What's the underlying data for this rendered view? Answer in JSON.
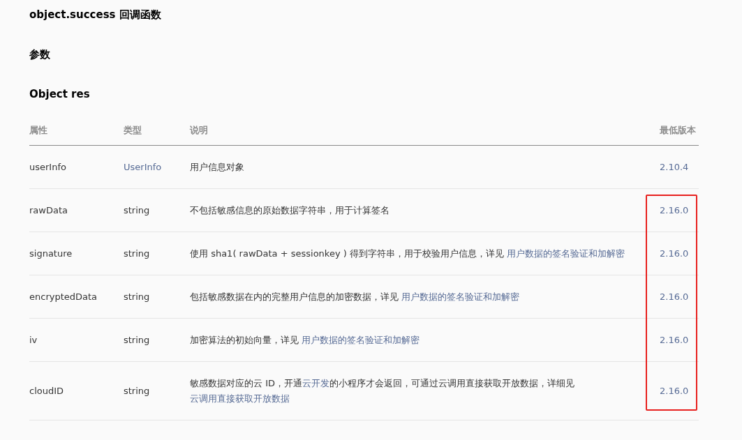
{
  "title": "object.success 回调函数",
  "section": "参数",
  "object_title": "Object res",
  "table": {
    "columns": [
      "属性",
      "类型",
      "说明",
      "最低版本"
    ],
    "rows": [
      {
        "name": "userInfo",
        "type": "UserInfo",
        "type_link": true,
        "description": [
          {
            "text": "用户信息对象",
            "link": false
          }
        ],
        "version": "2.10.4",
        "highlighted": false
      },
      {
        "name": "rawData",
        "type": "string",
        "type_link": false,
        "description": [
          {
            "text": "不包括敏感信息的原始数据字符串，用于计算签名",
            "link": false
          }
        ],
        "version": "2.16.0",
        "highlighted": true
      },
      {
        "name": "signature",
        "type": "string",
        "type_link": false,
        "description": [
          {
            "text": "使用 sha1( rawData + sessionkey ) 得到字符串，用于校验用户信息，详见 ",
            "link": false
          },
          {
            "text": "用户数据的签名验证和加解密",
            "link": true
          }
        ],
        "version": "2.16.0",
        "highlighted": true
      },
      {
        "name": "encryptedData",
        "type": "string",
        "type_link": false,
        "description": [
          {
            "text": "包括敏感数据在内的完整用户信息的加密数据，详见 ",
            "link": false
          },
          {
            "text": "用户数据的签名验证和加解密",
            "link": true
          }
        ],
        "version": "2.16.0",
        "highlighted": true
      },
      {
        "name": "iv",
        "type": "string",
        "type_link": false,
        "description": [
          {
            "text": "加密算法的初始向量，详见 ",
            "link": false
          },
          {
            "text": "用户数据的签名验证和加解密",
            "link": true
          }
        ],
        "version": "2.16.0",
        "highlighted": true
      },
      {
        "name": "cloudID",
        "type": "string",
        "type_link": false,
        "description": [
          {
            "text": "敏感数据对应的云 ID，开通",
            "link": false
          },
          {
            "text": "云开发",
            "link": true
          },
          {
            "text": "的小程序才会返回，可通过云调用直接获取开放数据，详细见",
            "link": false
          },
          {
            "text": "云调用直接获取开放数据",
            "link": true
          }
        ],
        "version": "2.16.0",
        "highlighted": true
      }
    ]
  }
}
